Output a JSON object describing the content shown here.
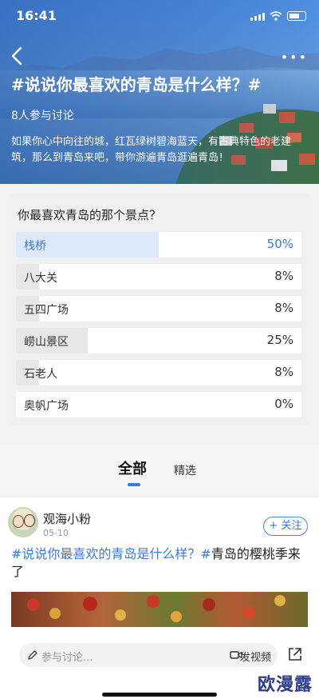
{
  "status_bar": {
    "time": "16:41"
  },
  "header": {
    "topic_title": "#说说你最喜欢的青岛是什么样？#",
    "participants": "8人参与讨论",
    "description": "如果你心中向往的城，红瓦绿树碧海蓝天，有古典特色的老建筑，那么到青岛来吧，带你游遍青岛逛遍青岛！",
    "back_icon": "chevron-left-icon",
    "more_icon": "more-dots-icon"
  },
  "poll": {
    "question": "你最喜欢青岛的那个景点？",
    "options": [
      {
        "label": "栈桥",
        "percent_text": "50%",
        "value": 50,
        "selected": true
      },
      {
        "label": "八大关",
        "percent_text": "8%",
        "value": 8,
        "selected": false
      },
      {
        "label": "五四广场",
        "percent_text": "8%",
        "value": 8,
        "selected": false
      },
      {
        "label": "崂山景区",
        "percent_text": "25%",
        "value": 25,
        "selected": false
      },
      {
        "label": "石老人",
        "percent_text": "8%",
        "value": 8,
        "selected": false
      },
      {
        "label": "奥帆广场",
        "percent_text": "0%",
        "value": 0,
        "selected": false
      }
    ]
  },
  "tabs": {
    "all": "全部",
    "featured": "精选"
  },
  "post": {
    "username": "观海小粉",
    "date": "05-10",
    "follow_label": "+ 关注",
    "text_tag": "#说说你最喜欢的青岛是什么样？#",
    "text_body": "青岛的樱桃季来了"
  },
  "comment_bar": {
    "placeholder": "参与讨论...",
    "video_label": "发视频"
  },
  "watermark": "欧漫露",
  "colors": {
    "accent": "#3a7ad6",
    "selected_fill": "#dce9fb"
  }
}
